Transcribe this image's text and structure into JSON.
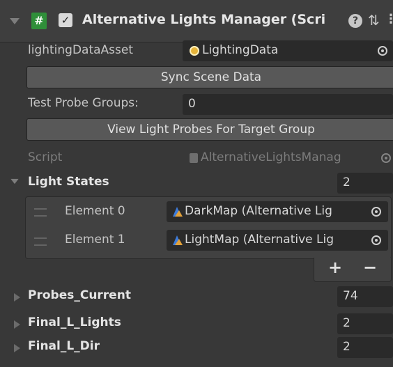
{
  "component": {
    "title": "Alternative Lights Manager (Scri",
    "script_icon": "#",
    "enabled_check": "✓"
  },
  "fields": {
    "lighting_data_asset": {
      "label": "lightingDataAsset",
      "value": "LightingData"
    },
    "sync_button": "Sync Scene Data",
    "test_probe_groups": {
      "label": "Test Probe Groups:",
      "value": "0"
    },
    "view_light_probes_button": "View Light Probes For Target Group",
    "script": {
      "label": "Script",
      "value": "AlternativeLightsManag"
    }
  },
  "light_states": {
    "label": "Light States",
    "count": "2",
    "elements": [
      {
        "label": "Element 0",
        "value": "DarkMap (Alternative Lig"
      },
      {
        "label": "Element 1",
        "value": "LightMap (Alternative Lig"
      }
    ],
    "add": "+",
    "remove": "−"
  },
  "foldouts": [
    {
      "label": "Probes_Current",
      "value": "74"
    },
    {
      "label": "Final_L_Lights",
      "value": "2"
    },
    {
      "label": "Final_L_Dir",
      "value": "2"
    }
  ],
  "colors": {
    "background": "#383838",
    "field": "#2a2a2a",
    "button": "#585858",
    "script_icon": "#2f8f39"
  },
  "icons": [
    "collapse-triangle-icon",
    "script-icon",
    "checkbox-icon",
    "help-icon",
    "preset-icon",
    "menu-icon",
    "lighting-data-icon",
    "object-picker-icon",
    "script-asset-icon",
    "scriptable-object-icon",
    "drag-handle-icon",
    "foldout-triangle-icon"
  ]
}
